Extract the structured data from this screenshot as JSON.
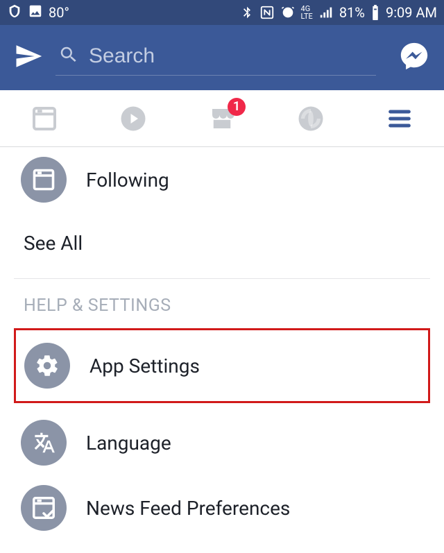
{
  "status": {
    "temp": "80°",
    "battery": "81%",
    "time": "9:09 AM"
  },
  "search": {
    "placeholder": "Search"
  },
  "tabs": {
    "marketplace_badge": "1"
  },
  "menu": {
    "following": {
      "label": "Following"
    },
    "see_all": "See All",
    "section_header": "HELP & SETTINGS",
    "app_settings": {
      "label": "App Settings"
    },
    "language": {
      "label": "Language"
    },
    "news_feed_prefs": {
      "label": "News Feed Preferences"
    }
  }
}
